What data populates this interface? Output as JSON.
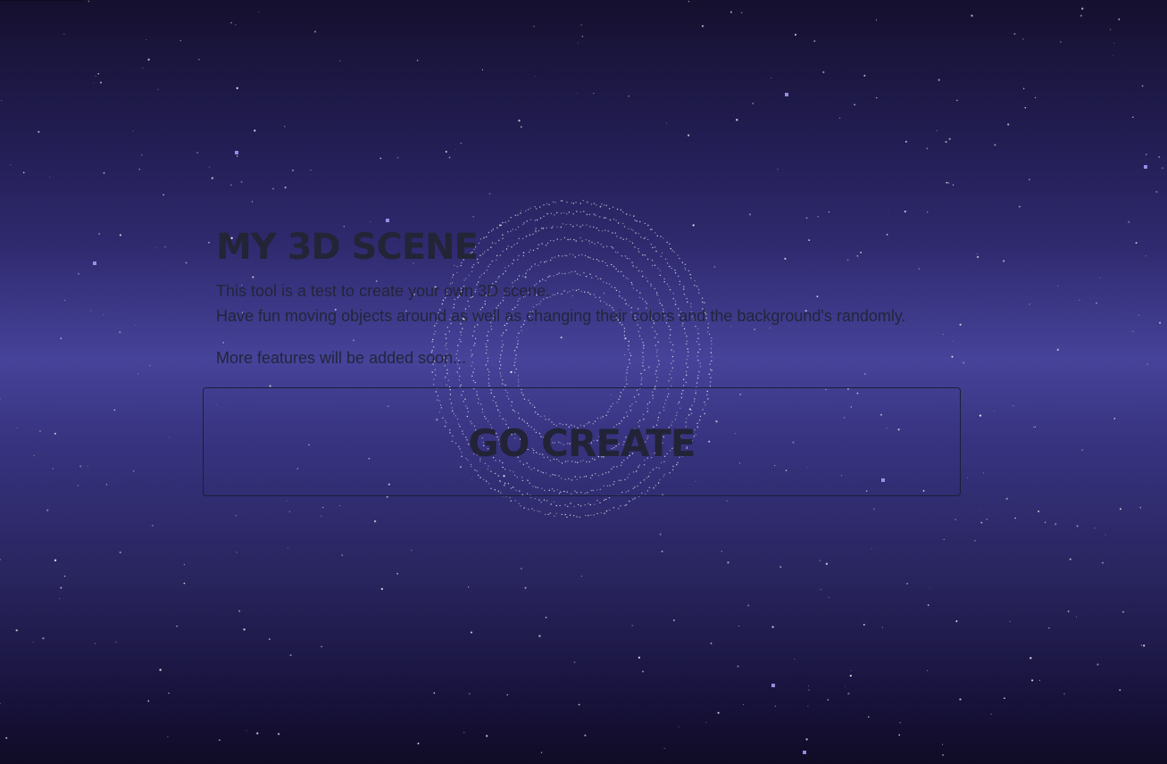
{
  "page": {
    "title": "MY 3D SCENE",
    "description_lines": [
      "This tool is a test to create your own 3D scene.",
      "Have fun moving objects around as well as changing their colors and the background's randomly."
    ],
    "note": "More features will be added soon...",
    "cta_label": "GO CREATE"
  },
  "colors": {
    "text": "#24253a",
    "star": "#ffffff",
    "accent_star": "#a9a2ff"
  }
}
